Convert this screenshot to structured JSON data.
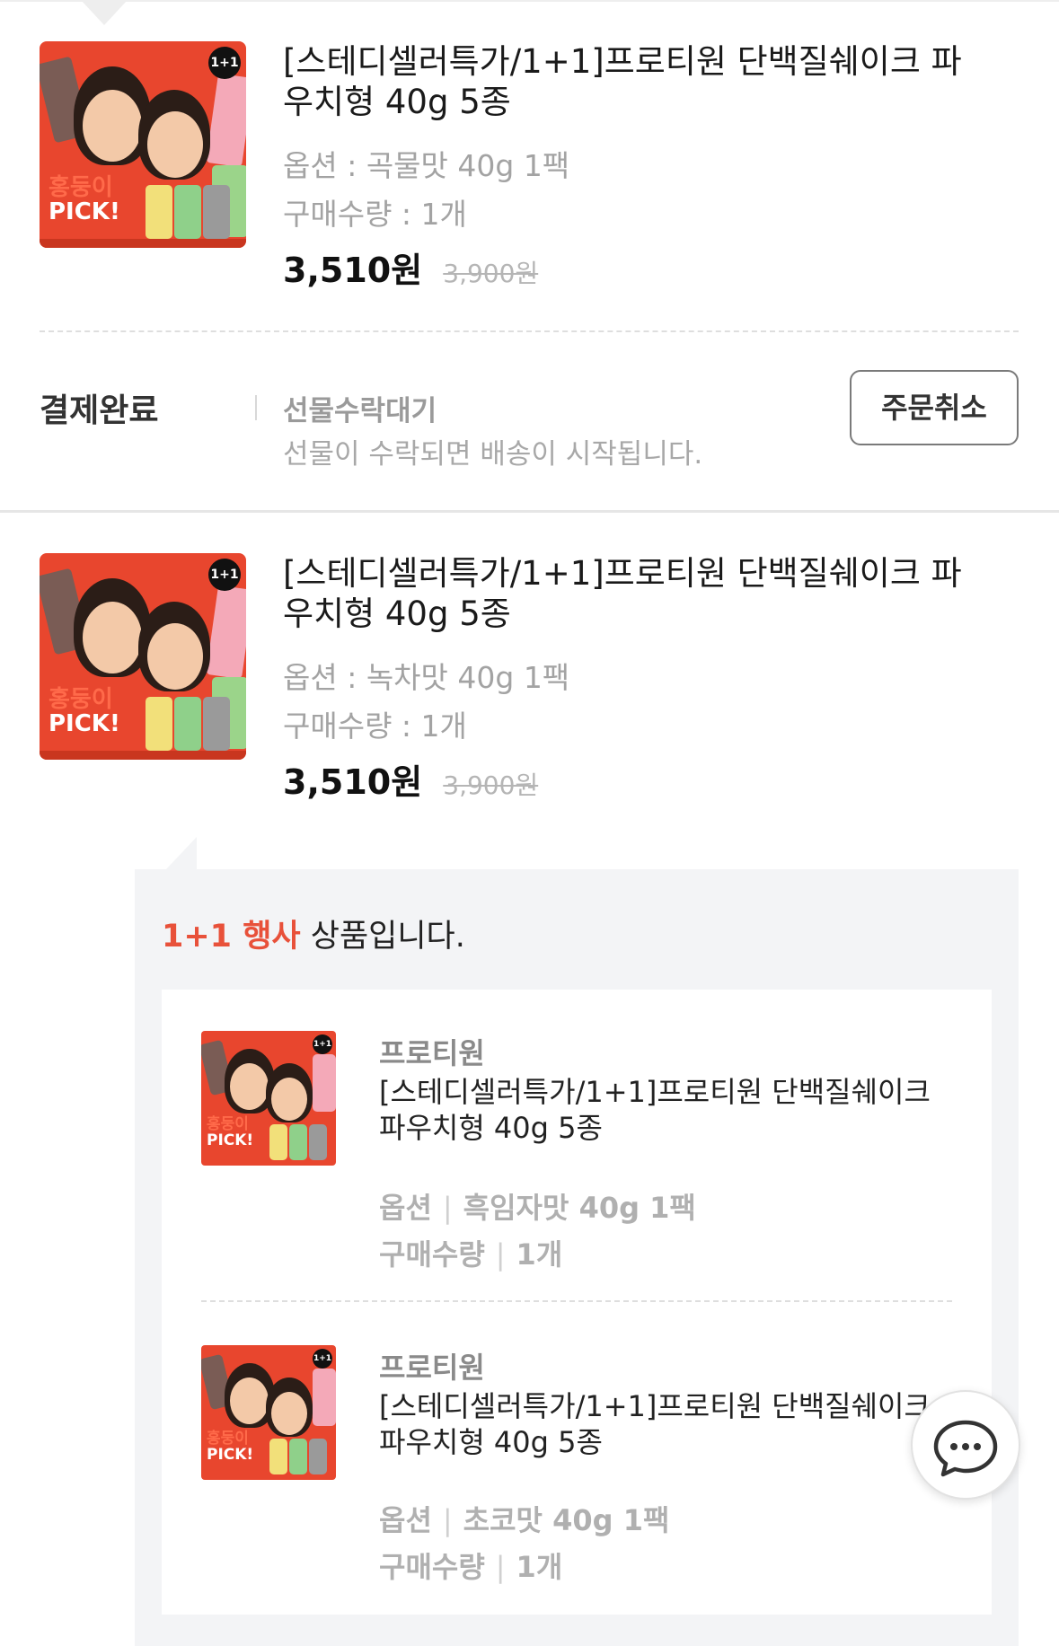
{
  "order_items": [
    {
      "title": "[스테디셀러특가/1+1]프로티원 단백질쉐이크 파우치형 40g 5종",
      "option": "옵션 : 곡물맛 40g 1팩",
      "quantity": "구매수량 : 1개",
      "price": "3,510원",
      "original_price": "3,900원"
    },
    {
      "title": "[스테디셀러특가/1+1]프로티원 단백질쉐이크 파우치형 40g 5종",
      "option": "옵션 : 녹차맛 40g 1팩",
      "quantity": "구매수량 : 1개",
      "price": "3,510원",
      "original_price": "3,900원"
    }
  ],
  "order_status": {
    "label": "결제완료",
    "gift_status": "선물수락대기",
    "gift_message": "선물이 수락되면 배송이 시작됩니다.",
    "cancel_button": "주문취소"
  },
  "promo": {
    "highlight": "1+1 행사",
    "text": " 상품입니다.",
    "items": [
      {
        "brand": "프로티원",
        "title": "[스테디셀러특가/1+1]프로티원 단백질쉐이크 파우치형 40g 5종",
        "option_label": "옵션",
        "option_value": "흑임자맛 40g 1팩",
        "quantity_label": "구매수량",
        "quantity_value": "1개"
      },
      {
        "brand": "프로티원",
        "title": "[스테디셀러특가/1+1]프로티원 단백질쉐이크 파우치형 40g 5종",
        "option_label": "옵션",
        "option_value": "초코맛 40g 1팩",
        "quantity_label": "구매수량",
        "quantity_value": "1개"
      }
    ]
  },
  "thumbnail": {
    "badge": "1+1",
    "pick_line1": "홍둥이",
    "pick_line2": "PICK!"
  },
  "icons": {
    "chat": "chat-bubble-icon"
  },
  "colors": {
    "accent": "#e8513a",
    "thumbnail_bg": "#e8462e"
  }
}
